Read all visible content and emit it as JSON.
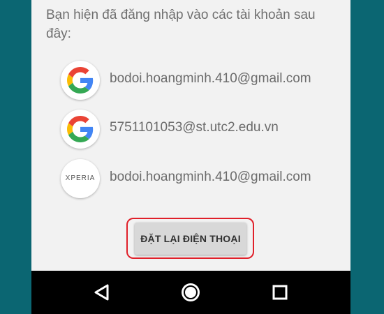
{
  "intro_text": "Bạn hiện đã đăng nhập vào các tài khoản sau đây:",
  "accounts": [
    {
      "icon": "google-icon",
      "email": "bodoi.hoangminh.410@gmail.com"
    },
    {
      "icon": "google-icon",
      "email": "5751101053@st.utc2.edu.vn"
    },
    {
      "icon": "xperia-icon",
      "logo_text": "XPERIA",
      "email": "bodoi.hoangminh.410@gmail.com"
    }
  ],
  "reset_button_label": "ĐẶT LẠI ĐIỆN THOẠI",
  "highlight_color": "#e0202a",
  "navbar": {
    "back_icon": "back-triangle-icon",
    "home_icon": "home-circle-icon",
    "recents_icon": "recents-square-icon"
  }
}
